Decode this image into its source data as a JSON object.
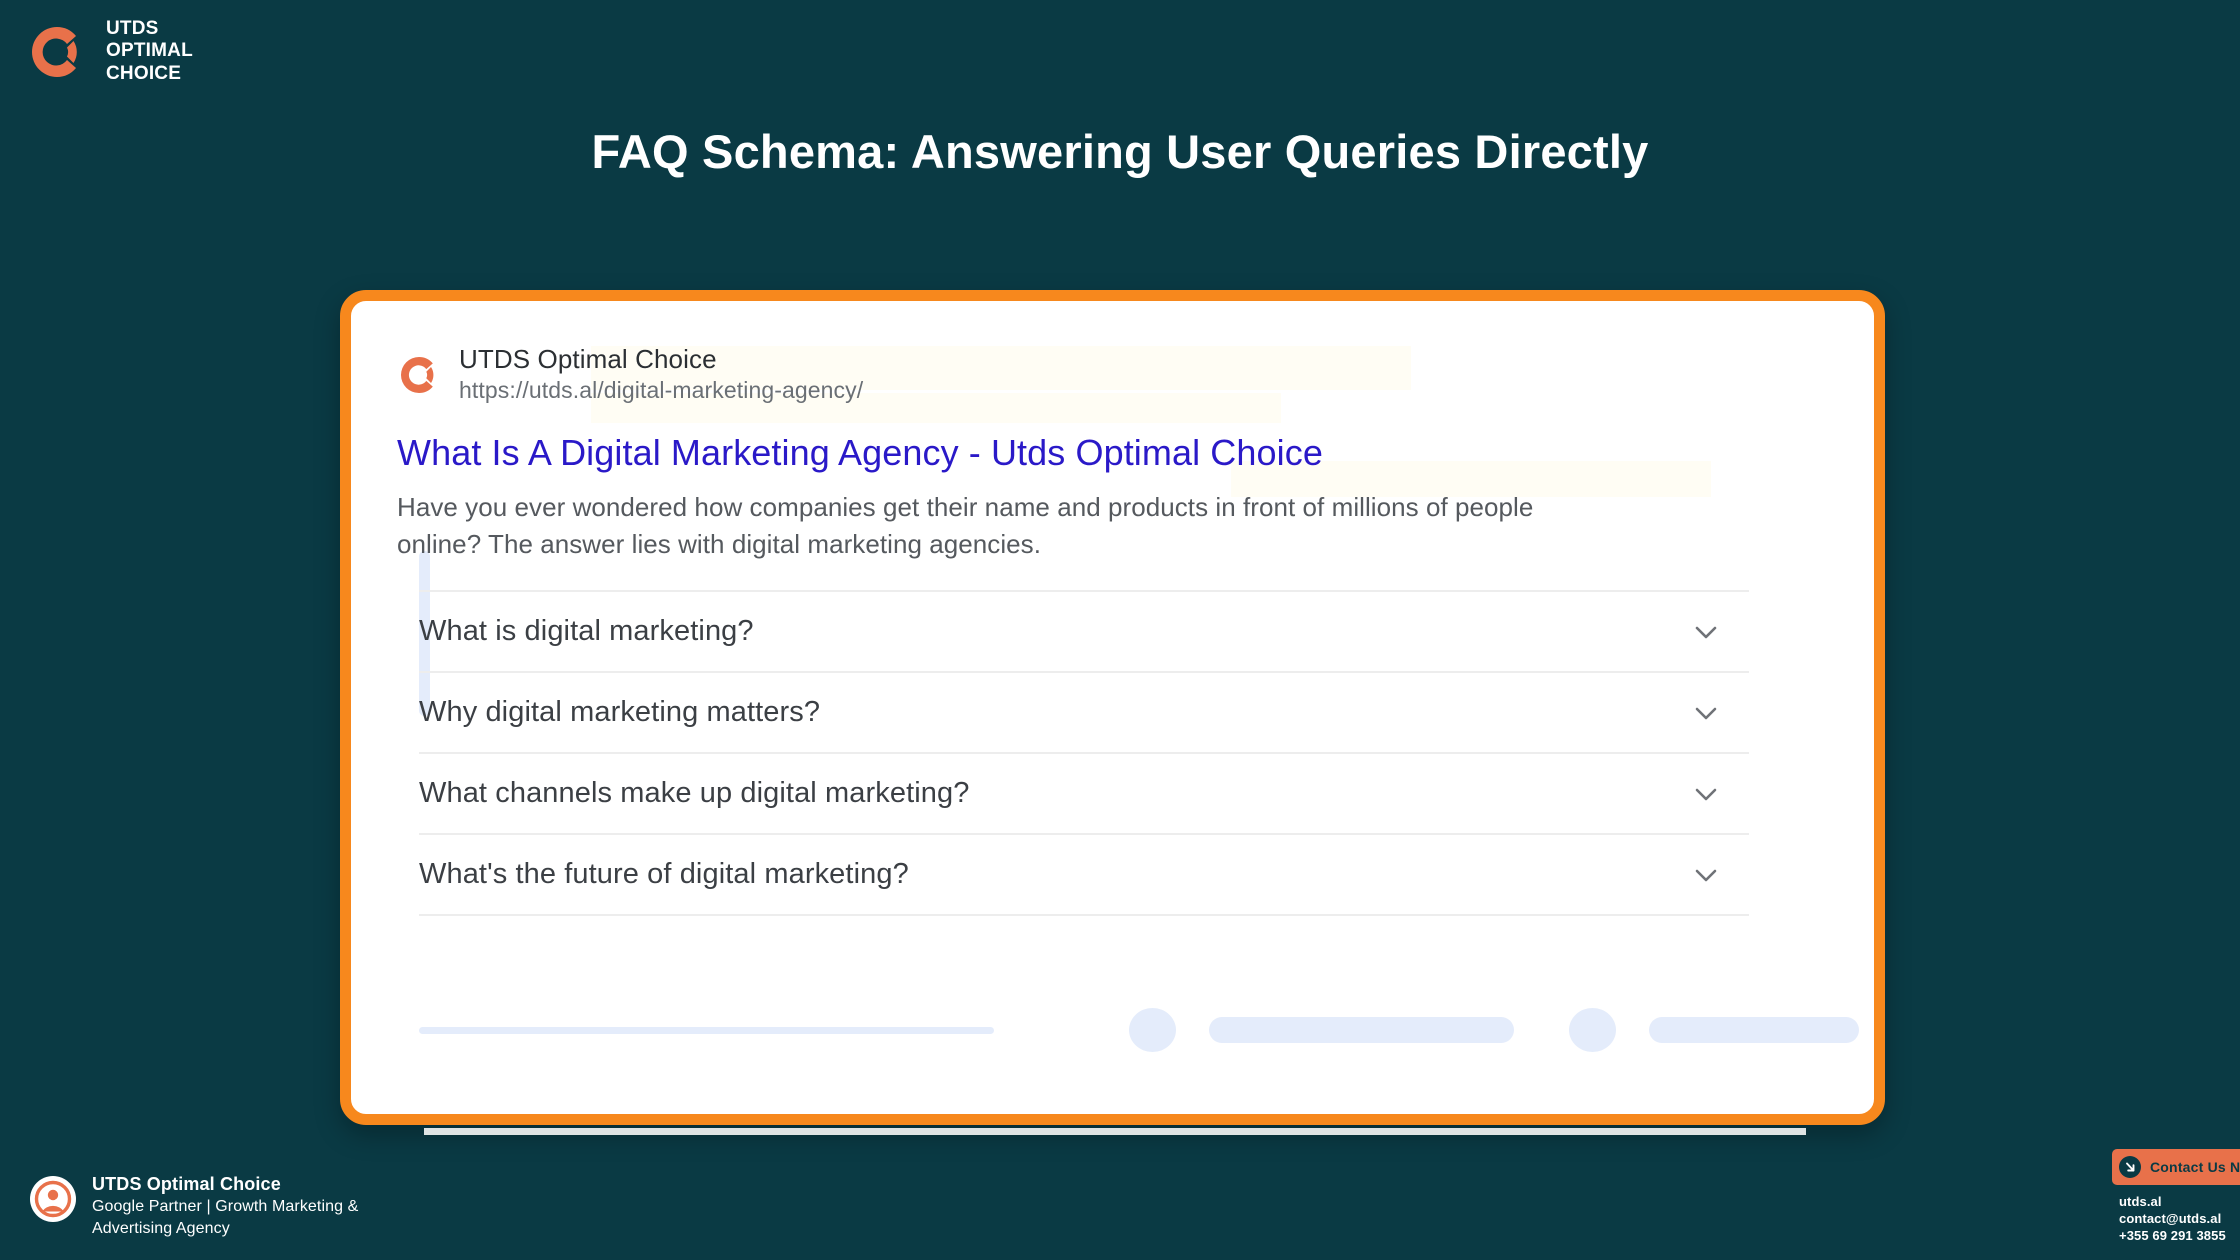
{
  "colors": {
    "background": "#0a3a44",
    "accent_orange": "#F7881D",
    "logo_orange": "#E8714A",
    "link_blue": "#2a19c8",
    "skeleton_blue": "#e4ecfb"
  },
  "brand": {
    "icon": "utds-logo-icon",
    "line1": "UTDS",
    "line2": "OPTIMAL",
    "line3": "CHOICE"
  },
  "slide": {
    "title": "FAQ Schema:  Answering User Queries Directly"
  },
  "serp": {
    "favicon": "utds-favicon-icon",
    "site_name": "UTDS Optimal Choice",
    "url": "https://utds.al/digital-marketing-agency/",
    "result_title": "What Is A Digital Marketing Agency - Utds Optimal Choice",
    "snippet": "Have you ever wondered how companies get their name and products in front of millions of people online? The answer lies with digital marketing agencies.",
    "faq_items": [
      {
        "question": "What is digital marketing?",
        "chevron": "chevron-down-icon"
      },
      {
        "question": "Why digital marketing matters?",
        "chevron": "chevron-down-icon"
      },
      {
        "question": "What channels make up digital marketing?",
        "chevron": "chevron-down-icon"
      },
      {
        "question": "What's the future of digital marketing?",
        "chevron": "chevron-down-icon"
      }
    ]
  },
  "footer": {
    "avatar": "user-avatar-icon",
    "name": "UTDS Optimal Choice",
    "subtitle": "Google Partner | Growth Marketing & Advertising Agency"
  },
  "contact": {
    "icon": "arrow-down-right-icon",
    "label": "Contact Us Now",
    "website": "utds.al",
    "email": "contact@utds.al",
    "phone": "+355 69 291 3855"
  }
}
